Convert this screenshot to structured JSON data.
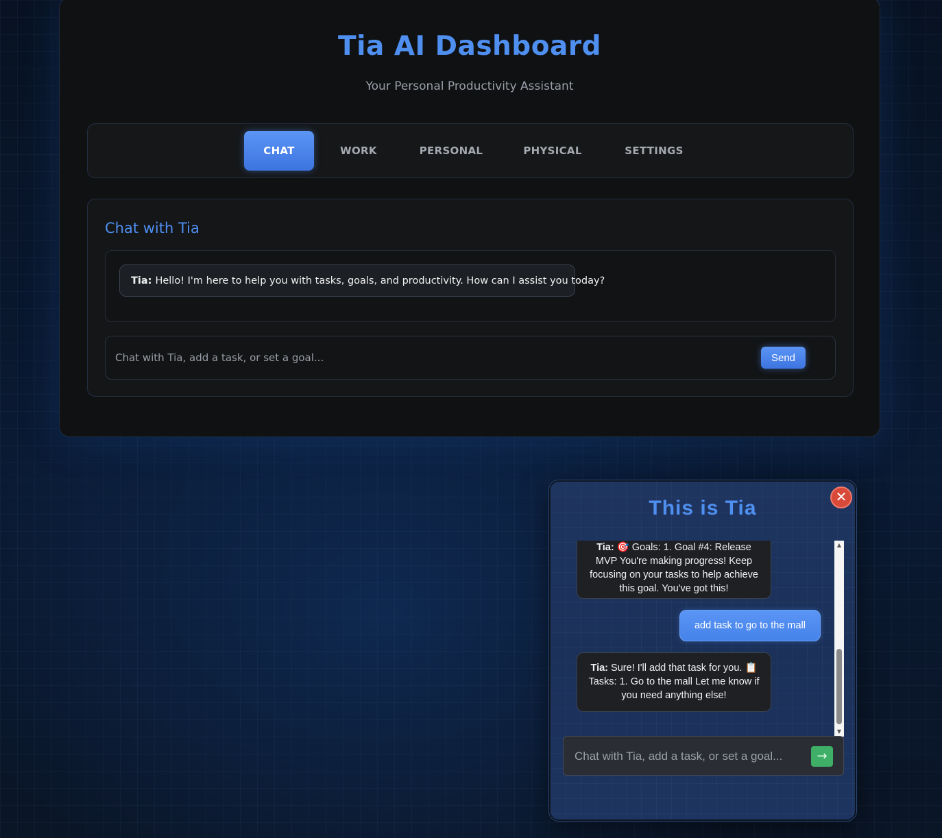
{
  "header": {
    "title": "Tia AI Dashboard",
    "subtitle": "Your Personal Productivity Assistant"
  },
  "tabs": [
    {
      "label": "CHAT",
      "active": true
    },
    {
      "label": "WORK",
      "active": false
    },
    {
      "label": "PERSONAL",
      "active": false
    },
    {
      "label": "PHYSICAL",
      "active": false
    },
    {
      "label": "SETTINGS",
      "active": false
    }
  ],
  "chat": {
    "title": "Chat with Tia",
    "messages": [
      {
        "sender": "Tia:",
        "text": "Hello! I'm here to help you with tasks, goals, and productivity. How can I assist you today?"
      }
    ],
    "input_placeholder": "Chat with Tia, add a task, or set a goal...",
    "send_label": "Send"
  },
  "widget": {
    "title": "This is Tia",
    "close_icon": "close-icon",
    "messages": [
      {
        "role": "bot",
        "sender": "Tia:",
        "text": "🎯 Goals: 1. Goal #4: Release MVP You're making progress! Keep focusing on your tasks to help achieve this goal. You've got this!"
      },
      {
        "role": "user",
        "text": "add task to go to the mall"
      },
      {
        "role": "bot",
        "sender": "Tia:",
        "text": "Sure! I'll add that task for you. 📋 Tasks: 1. Go to the mall Let me know if you need anything else!"
      }
    ],
    "input_placeholder": "Chat with Tia, add a task, or set a goal...",
    "send_icon": "→"
  },
  "colors": {
    "accent": "#4f8ff0",
    "close": "#d9493a",
    "send_green": "#3fae66"
  }
}
